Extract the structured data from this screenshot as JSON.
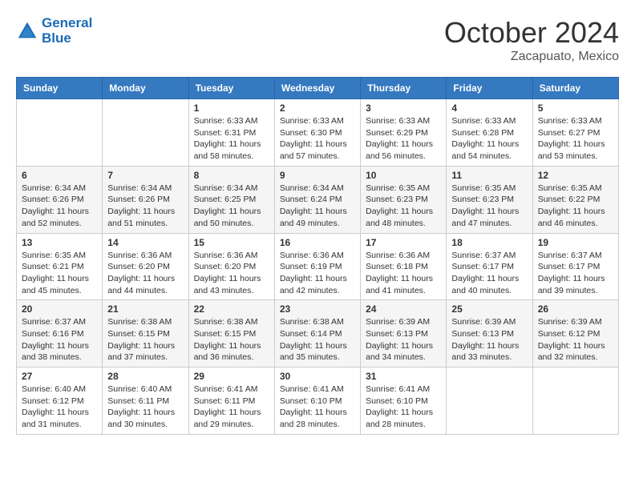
{
  "header": {
    "logo_line1": "General",
    "logo_line2": "Blue",
    "month": "October 2024",
    "location": "Zacapuato, Mexico"
  },
  "weekdays": [
    "Sunday",
    "Monday",
    "Tuesday",
    "Wednesday",
    "Thursday",
    "Friday",
    "Saturday"
  ],
  "weeks": [
    [
      {
        "day": "",
        "sunrise": "",
        "sunset": "",
        "daylight": ""
      },
      {
        "day": "",
        "sunrise": "",
        "sunset": "",
        "daylight": ""
      },
      {
        "day": "1",
        "sunrise": "Sunrise: 6:33 AM",
        "sunset": "Sunset: 6:31 PM",
        "daylight": "Daylight: 11 hours and 58 minutes."
      },
      {
        "day": "2",
        "sunrise": "Sunrise: 6:33 AM",
        "sunset": "Sunset: 6:30 PM",
        "daylight": "Daylight: 11 hours and 57 minutes."
      },
      {
        "day": "3",
        "sunrise": "Sunrise: 6:33 AM",
        "sunset": "Sunset: 6:29 PM",
        "daylight": "Daylight: 11 hours and 56 minutes."
      },
      {
        "day": "4",
        "sunrise": "Sunrise: 6:33 AM",
        "sunset": "Sunset: 6:28 PM",
        "daylight": "Daylight: 11 hours and 54 minutes."
      },
      {
        "day": "5",
        "sunrise": "Sunrise: 6:33 AM",
        "sunset": "Sunset: 6:27 PM",
        "daylight": "Daylight: 11 hours and 53 minutes."
      }
    ],
    [
      {
        "day": "6",
        "sunrise": "Sunrise: 6:34 AM",
        "sunset": "Sunset: 6:26 PM",
        "daylight": "Daylight: 11 hours and 52 minutes."
      },
      {
        "day": "7",
        "sunrise": "Sunrise: 6:34 AM",
        "sunset": "Sunset: 6:26 PM",
        "daylight": "Daylight: 11 hours and 51 minutes."
      },
      {
        "day": "8",
        "sunrise": "Sunrise: 6:34 AM",
        "sunset": "Sunset: 6:25 PM",
        "daylight": "Daylight: 11 hours and 50 minutes."
      },
      {
        "day": "9",
        "sunrise": "Sunrise: 6:34 AM",
        "sunset": "Sunset: 6:24 PM",
        "daylight": "Daylight: 11 hours and 49 minutes."
      },
      {
        "day": "10",
        "sunrise": "Sunrise: 6:35 AM",
        "sunset": "Sunset: 6:23 PM",
        "daylight": "Daylight: 11 hours and 48 minutes."
      },
      {
        "day": "11",
        "sunrise": "Sunrise: 6:35 AM",
        "sunset": "Sunset: 6:23 PM",
        "daylight": "Daylight: 11 hours and 47 minutes."
      },
      {
        "day": "12",
        "sunrise": "Sunrise: 6:35 AM",
        "sunset": "Sunset: 6:22 PM",
        "daylight": "Daylight: 11 hours and 46 minutes."
      }
    ],
    [
      {
        "day": "13",
        "sunrise": "Sunrise: 6:35 AM",
        "sunset": "Sunset: 6:21 PM",
        "daylight": "Daylight: 11 hours and 45 minutes."
      },
      {
        "day": "14",
        "sunrise": "Sunrise: 6:36 AM",
        "sunset": "Sunset: 6:20 PM",
        "daylight": "Daylight: 11 hours and 44 minutes."
      },
      {
        "day": "15",
        "sunrise": "Sunrise: 6:36 AM",
        "sunset": "Sunset: 6:20 PM",
        "daylight": "Daylight: 11 hours and 43 minutes."
      },
      {
        "day": "16",
        "sunrise": "Sunrise: 6:36 AM",
        "sunset": "Sunset: 6:19 PM",
        "daylight": "Daylight: 11 hours and 42 minutes."
      },
      {
        "day": "17",
        "sunrise": "Sunrise: 6:36 AM",
        "sunset": "Sunset: 6:18 PM",
        "daylight": "Daylight: 11 hours and 41 minutes."
      },
      {
        "day": "18",
        "sunrise": "Sunrise: 6:37 AM",
        "sunset": "Sunset: 6:17 PM",
        "daylight": "Daylight: 11 hours and 40 minutes."
      },
      {
        "day": "19",
        "sunrise": "Sunrise: 6:37 AM",
        "sunset": "Sunset: 6:17 PM",
        "daylight": "Daylight: 11 hours and 39 minutes."
      }
    ],
    [
      {
        "day": "20",
        "sunrise": "Sunrise: 6:37 AM",
        "sunset": "Sunset: 6:16 PM",
        "daylight": "Daylight: 11 hours and 38 minutes."
      },
      {
        "day": "21",
        "sunrise": "Sunrise: 6:38 AM",
        "sunset": "Sunset: 6:15 PM",
        "daylight": "Daylight: 11 hours and 37 minutes."
      },
      {
        "day": "22",
        "sunrise": "Sunrise: 6:38 AM",
        "sunset": "Sunset: 6:15 PM",
        "daylight": "Daylight: 11 hours and 36 minutes."
      },
      {
        "day": "23",
        "sunrise": "Sunrise: 6:38 AM",
        "sunset": "Sunset: 6:14 PM",
        "daylight": "Daylight: 11 hours and 35 minutes."
      },
      {
        "day": "24",
        "sunrise": "Sunrise: 6:39 AM",
        "sunset": "Sunset: 6:13 PM",
        "daylight": "Daylight: 11 hours and 34 minutes."
      },
      {
        "day": "25",
        "sunrise": "Sunrise: 6:39 AM",
        "sunset": "Sunset: 6:13 PM",
        "daylight": "Daylight: 11 hours and 33 minutes."
      },
      {
        "day": "26",
        "sunrise": "Sunrise: 6:39 AM",
        "sunset": "Sunset: 6:12 PM",
        "daylight": "Daylight: 11 hours and 32 minutes."
      }
    ],
    [
      {
        "day": "27",
        "sunrise": "Sunrise: 6:40 AM",
        "sunset": "Sunset: 6:12 PM",
        "daylight": "Daylight: 11 hours and 31 minutes."
      },
      {
        "day": "28",
        "sunrise": "Sunrise: 6:40 AM",
        "sunset": "Sunset: 6:11 PM",
        "daylight": "Daylight: 11 hours and 30 minutes."
      },
      {
        "day": "29",
        "sunrise": "Sunrise: 6:41 AM",
        "sunset": "Sunset: 6:11 PM",
        "daylight": "Daylight: 11 hours and 29 minutes."
      },
      {
        "day": "30",
        "sunrise": "Sunrise: 6:41 AM",
        "sunset": "Sunset: 6:10 PM",
        "daylight": "Daylight: 11 hours and 28 minutes."
      },
      {
        "day": "31",
        "sunrise": "Sunrise: 6:41 AM",
        "sunset": "Sunset: 6:10 PM",
        "daylight": "Daylight: 11 hours and 28 minutes."
      },
      {
        "day": "",
        "sunrise": "",
        "sunset": "",
        "daylight": ""
      },
      {
        "day": "",
        "sunrise": "",
        "sunset": "",
        "daylight": ""
      }
    ]
  ]
}
